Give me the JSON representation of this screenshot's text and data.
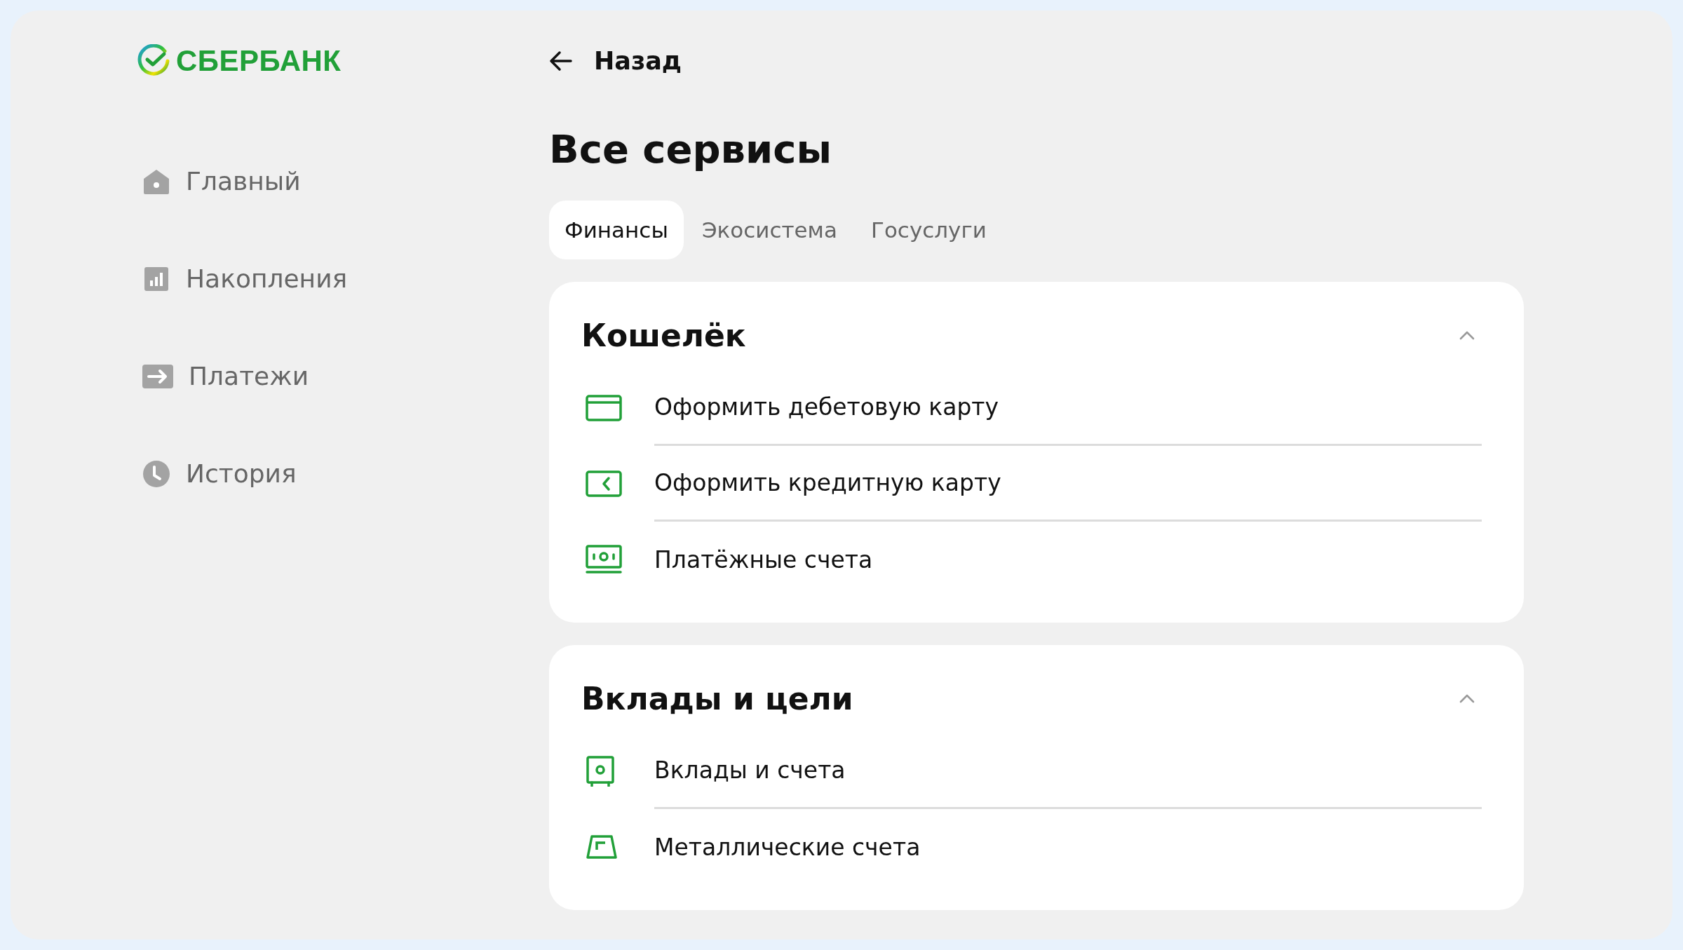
{
  "logo": {
    "text": "СБЕРБАНК"
  },
  "sidebar": {
    "items": [
      {
        "label": "Главный",
        "kind": "home",
        "selected": false
      },
      {
        "label": "Накопления",
        "kind": "chart",
        "selected": false
      },
      {
        "label": "Платежи",
        "kind": "transfer",
        "selected": false
      },
      {
        "label": "История",
        "kind": "clock",
        "selected": false
      }
    ]
  },
  "back": {
    "label": "Назад"
  },
  "title": "Все сервисы",
  "tabs": [
    {
      "label": "Финансы",
      "selected": true
    },
    {
      "label": "Экосистема",
      "selected": false
    },
    {
      "label": "Госуслуги",
      "selected": false
    }
  ],
  "sections": [
    {
      "title": "Кошелёк",
      "expanded": true,
      "items": [
        {
          "label": "Оформить дебетовую карту",
          "kind": "card"
        },
        {
          "label": "Оформить кредитную карту",
          "kind": "credit"
        },
        {
          "label": "Платёжные счета",
          "kind": "cash"
        }
      ]
    },
    {
      "title": "Вклады и цели",
      "expanded": true,
      "items": [
        {
          "label": "Вклады и счета",
          "kind": "safe"
        },
        {
          "label": "Металлические счета",
          "kind": "ingot"
        }
      ]
    }
  ]
}
